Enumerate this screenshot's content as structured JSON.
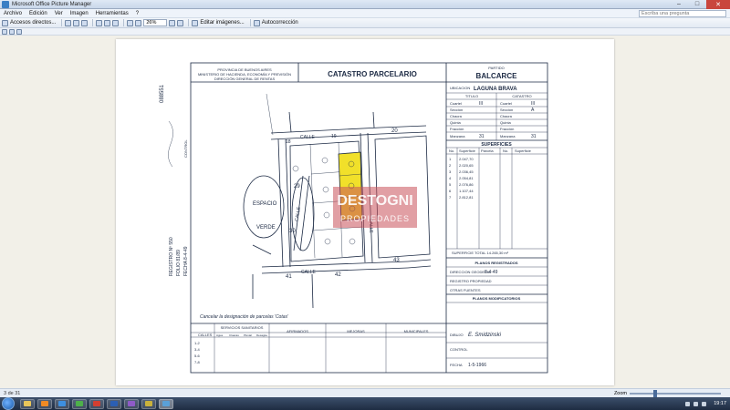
{
  "window": {
    "title": "Microsoft Office Picture Manager",
    "minimize": "–",
    "maximize": "□",
    "close": "✕"
  },
  "menu": {
    "items": [
      "Archivo",
      "Edición",
      "Ver",
      "Imagen",
      "Herramientas",
      "?"
    ],
    "help_placeholder": "Escriba una pregunta"
  },
  "toolbar": {
    "shortcuts": "Accesos directos...",
    "zoom": "26%",
    "edit_images": "Editar imágenes...",
    "autocorrect": "Autocorrección"
  },
  "document": {
    "header_left_1": "PROVINCIA DE BUENOS AIRES",
    "header_left_2": "MINISTERIO DE HACIENDA, ECONOMÍA Y PREVISIÓN",
    "header_left_3": "DIRECCIÓN GENERAL DE RENTAS",
    "title": "CATASTRO PARCELARIO",
    "partido_label": "PARTIDO",
    "partido": "BALCARCE",
    "ubicacion_label": "UBICACION",
    "ubicacion": "LAGUNA BRAVA",
    "titulo_label": "TITULO",
    "catastro_label": "CATASTRO",
    "rows": [
      "Cuartel",
      "Sección",
      "Chacra",
      "Quinta",
      "Fracción",
      "Manzana"
    ],
    "row_values_left": [
      "III",
      "",
      "",
      "",
      "",
      "31"
    ],
    "row_values_right": [
      "III",
      "A",
      "",
      "",
      "",
      "31"
    ],
    "superficies_label": "SUPERFICIES",
    "sup_headers": [
      "No.",
      "Superficie",
      "Parcela",
      "No.",
      "Superficie"
    ],
    "sup_values": [
      "2.047,70",
      "2.020,65",
      "2.036,45",
      "2.054,81",
      "2.076,86",
      "1.107,44",
      "2.812,81"
    ],
    "superficie_total": "SUPERFICIE TOTAL 14.265,30 m²",
    "planos_registrados": "PLANOS REGISTRADOS",
    "dir_geodesia": "DIRECCION GEODESIA",
    "dir_geodesia_val": "8-4-49",
    "registro_propiedad": "REGISTRO PROPIEDAD",
    "otras_fuentes": "OTRAS FUENTES",
    "planos_modificatorios": "PLANOS MODIFICATORIOS",
    "map_numbers": [
      "18",
      "19",
      "20",
      "29",
      "30",
      "41",
      "42",
      "43"
    ],
    "parcel_letters": [
      "a",
      "b",
      "c",
      "d",
      "e",
      "f",
      "g",
      "h"
    ],
    "calle_label": "CALLE",
    "espacio_verde_1": "ESPACIO",
    "espacio_verde_2": "VERDE",
    "note": "Cancelar la designación de parcelas 'Cotas'",
    "bottom_headers": [
      "CALLES",
      "SERVICIOS SANITARIOS",
      "AFIRMADOS",
      "MEJORAS",
      "MUNICIPALES"
    ],
    "service_cols": [
      "Agua",
      "Cloacas",
      "Pluvial",
      "Desagüe"
    ],
    "calles_rows": [
      "1-2",
      "3-4",
      "5-6",
      "7-8"
    ],
    "dibujo_label": "DIBUJO",
    "dibujo_val": "E. Smidzinski",
    "control_label": "CONTROL",
    "fecha_label": "FECHA",
    "fecha_val": "1-5-1966",
    "margin_registro": "REGISTRO Nº 550",
    "margin_folio": "FOLIO 81/89",
    "margin_fecha": "FECHA 8-4-49",
    "margin_control": "CONTROL",
    "serial": "088551",
    "watermark_1": "DESTOGNI",
    "watermark_2": "PROPIEDADES"
  },
  "status": {
    "pages": "3 de 31",
    "zoom_label": "Zoom"
  },
  "taskbar": {
    "clock": "19:17"
  },
  "colors": {
    "highlight": "#f1e02a",
    "watermark": "#c9505a",
    "ink": "#1c2a44"
  }
}
